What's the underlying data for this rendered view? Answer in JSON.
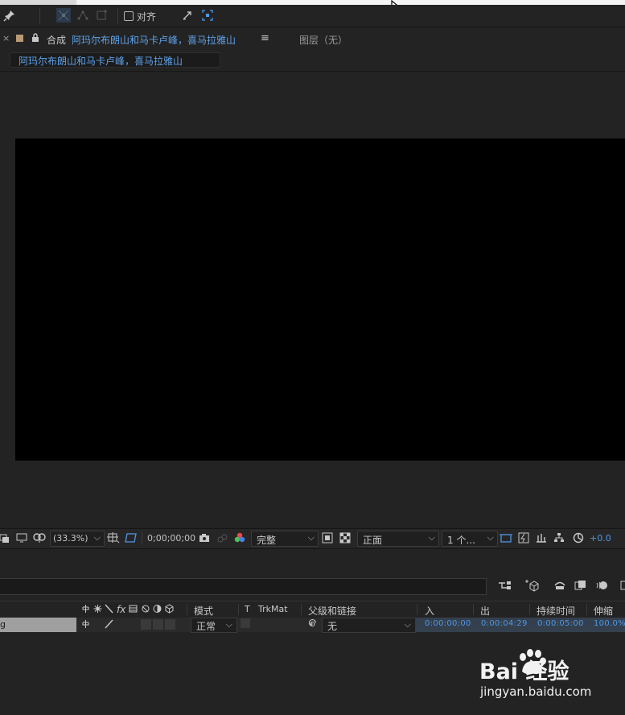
{
  "toolbar": {
    "align_label": "对齐"
  },
  "composition_tab": {
    "close_glyph": "×",
    "prefix": "合成",
    "name": "阿玛尔布朗山和马卡卢峰，喜马拉雅山",
    "menu_glyph": "≡",
    "label_color": "#b89a75"
  },
  "layer_tab": {
    "label": "图层（无）"
  },
  "breadcrumb": {
    "text": "阿玛尔布朗山和马卡卢峰，喜马拉雅山"
  },
  "viewer_bar": {
    "zoom": "(33.3%)",
    "timecode": "0;00;00;00",
    "resolution": "完整",
    "view": "正面",
    "views_count": "1 个...",
    "exposure": "+0.0"
  },
  "timeline": {
    "columns": {
      "mode": "模式",
      "t": "T",
      "trkmat": "TrkMat",
      "parent": "父级和链接",
      "in": "入",
      "out": "出",
      "duration": "持续时间",
      "stretch": "伸缩"
    },
    "layer": {
      "name": "g",
      "mode": "正常",
      "parent": "无",
      "in": "0:00:00:00",
      "out": "0:00:04:29",
      "duration": "0:00:05:00",
      "stretch": "100.0%"
    }
  },
  "watermark": {
    "logo_text": "Bai  经验",
    "url": "jingyan.baidu.com"
  },
  "colors": {
    "accent_blue": "#5ea1e8",
    "panel_bg": "#232323",
    "canvas_bg": "#000000"
  }
}
